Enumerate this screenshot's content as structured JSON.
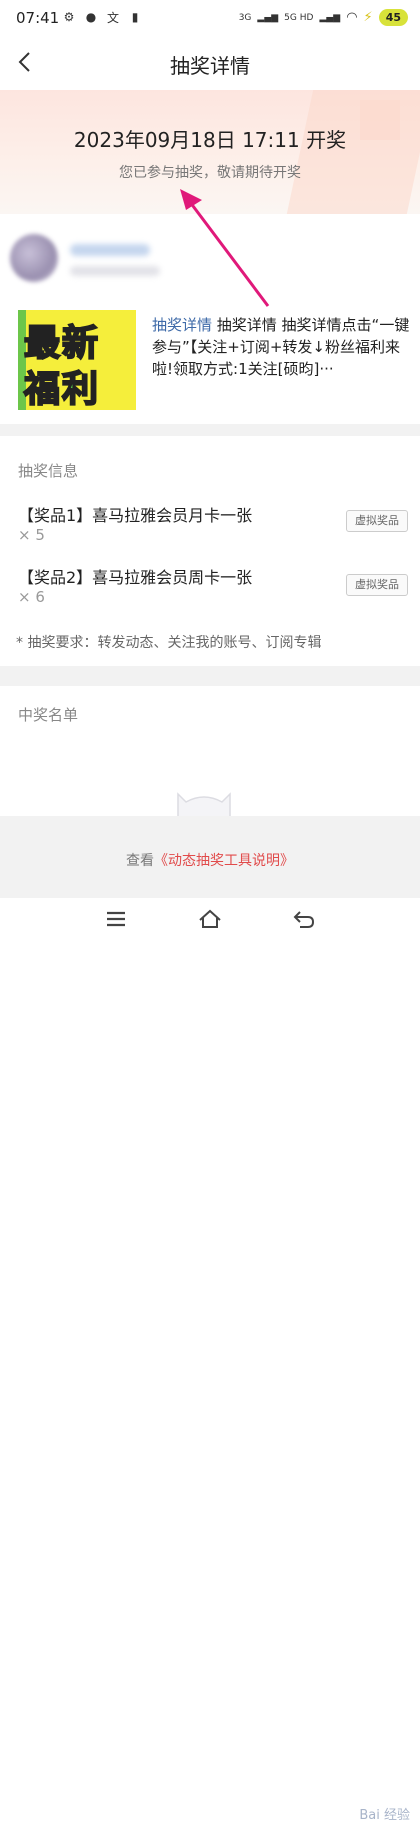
{
  "status_bar": {
    "time": "07:41",
    "network_left": "3G",
    "network_right": "5G HD",
    "battery": "45"
  },
  "nav": {
    "title": "抽奖详情"
  },
  "banner": {
    "draw_time": "2023年09月18日 17:11 开奖",
    "status": "您已参与抽奖，敬请期待开奖"
  },
  "post": {
    "thumbnail_text_line1": "最新",
    "thumbnail_text_line2": "福利",
    "link_text": "抽奖详情",
    "body_text": " 抽奖详情 抽奖详情点击“一键参与”【关注+订阅+转发↓粉丝福利来啦!领取方式:1关注[硕昀]···"
  },
  "prize_info": {
    "title": "抽奖信息",
    "prizes": [
      {
        "name": "【奖品1】喜马拉雅会员月卡一张",
        "qty": "× 5",
        "tag": "虚拟奖品"
      },
      {
        "name": "【奖品2】喜马拉雅会员周卡一张",
        "qty": "× 6",
        "tag": "虚拟奖品"
      }
    ],
    "requirement": "* 抽奖要求：转发动态、关注我的账号、订阅专辑"
  },
  "winners": {
    "title": "中奖名单"
  },
  "footer": {
    "prefix": "查看",
    "link": "《动态抽奖工具说明》"
  },
  "watermark": "Bai 经验",
  "colors": {
    "accent_red": "#e14b4b",
    "link_blue": "#3e6aa8",
    "annotation_arrow": "#e0197a",
    "banner_bg": "#fde5df",
    "battery_badge": "#d8e23a"
  },
  "icons": {
    "back": "chevron-left-icon",
    "menu": "hamburger-icon",
    "home": "home-icon",
    "return": "back-return-icon"
  }
}
